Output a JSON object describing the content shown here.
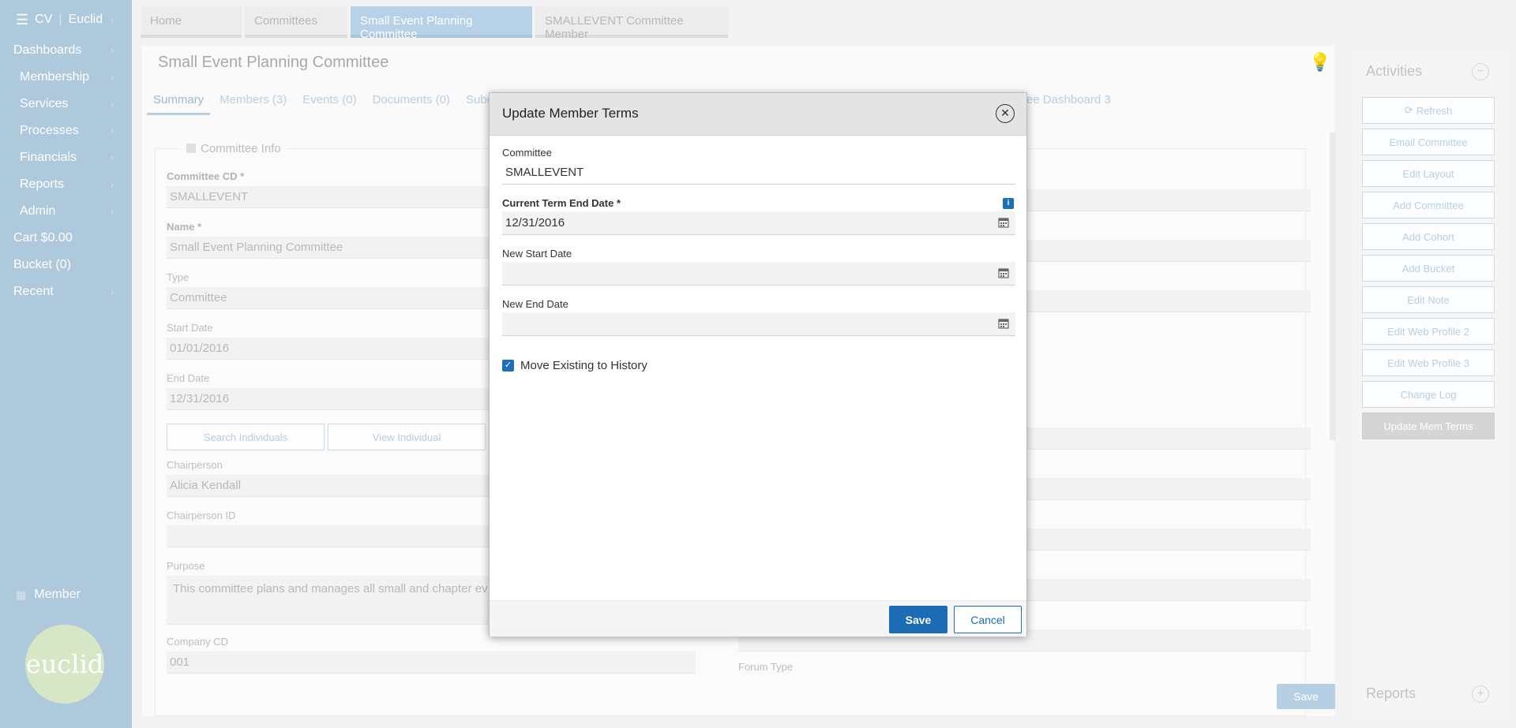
{
  "sidebar": {
    "brand_left": "CV",
    "brand_right": "Euclid",
    "items": [
      {
        "label": "Dashboards",
        "indent": false
      },
      {
        "label": "Membership",
        "indent": true
      },
      {
        "label": "Services",
        "indent": true
      },
      {
        "label": "Processes",
        "indent": true
      },
      {
        "label": "Financials",
        "indent": true
      },
      {
        "label": "Reports",
        "indent": true
      },
      {
        "label": "Admin",
        "indent": true
      },
      {
        "label": "Cart $0.00",
        "indent": false
      },
      {
        "label": "Bucket (0)",
        "indent": false
      },
      {
        "label": "Recent",
        "indent": false
      }
    ],
    "member_label": "Member",
    "logo_text": "euclid"
  },
  "top_tabs": [
    "Home",
    "Committees",
    "Small Event Planning Committee",
    "SMALLEVENT Committee Member"
  ],
  "page": {
    "title": "Small Event Planning Committee",
    "subtabs": [
      "Summary",
      "Members (3)",
      "Events (0)",
      "Documents (0)",
      "Subc"
    ],
    "subtab_right": "ee Dashboard 3",
    "section_title": "Committee Info",
    "fields": {
      "committee_cd_label": "Committee CD *",
      "committee_cd": "SMALLEVENT",
      "name_label": "Name *",
      "name": "Small Event Planning Committee",
      "type_label": "Type",
      "type": "Committee",
      "start_label": "Start Date",
      "start": "01/01/2016",
      "end_label": "End Date",
      "end": "12/31/2016",
      "chair_label": "Chairperson",
      "chair": "Alicia Kendall",
      "chair_id_label": "Chairperson ID",
      "purpose_label": "Purpose",
      "purpose": "This committee plans and manages all small and chapter ev",
      "company_label": "Company CD",
      "company": "001",
      "forum_label": "Forum Type"
    },
    "search_individuals": "Search Individuals",
    "view_individual": "View Individual",
    "save": "Save"
  },
  "activities": {
    "title": "Activities",
    "buttons": [
      "Refresh",
      "Email Committee",
      "Edit Layout",
      "Add Committee",
      "Add Cohort",
      "Add Bucket",
      "Edit Note",
      "Edit Web Profile 2",
      "Edit Web Profile 3",
      "Change Log",
      "Update Mem Terms"
    ],
    "reports_title": "Reports"
  },
  "modal": {
    "title": "Update Member Terms",
    "committee_label": "Committee",
    "committee_value": "SMALLEVENT",
    "current_end_label": "Current Term End Date *",
    "current_end_value": "12/31/2016",
    "new_start_label": "New Start Date",
    "new_start_value": "",
    "new_end_label": "New End Date",
    "new_end_value": "",
    "move_label": "Move Existing to History",
    "save": "Save",
    "cancel": "Cancel"
  }
}
